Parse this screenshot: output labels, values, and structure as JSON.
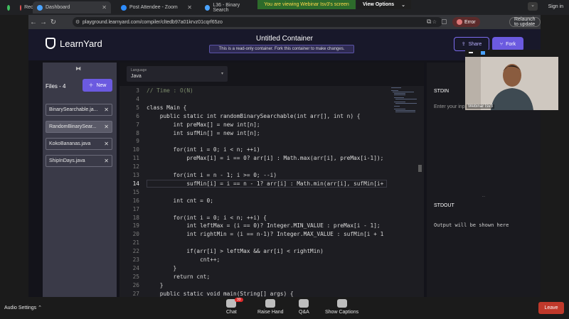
{
  "tabs": [
    {
      "label": "Recording",
      "color": "#e05555"
    },
    {
      "label": "Dashboard",
      "color": "#4aa3ff"
    },
    {
      "label": "Post Attendee - Zoom",
      "color": "#2d8cff"
    },
    {
      "label": "L36 - Binary Search",
      "color": "#4aa3ff"
    }
  ],
  "zoom_banner": "You are viewing Webinar Isv3's screen",
  "view_options": "View Options",
  "sign_in": "Sign in",
  "url": "playground.learnyard.com/compiler/cltedb97a01krvz01cqrf65zo",
  "error_label": "Error",
  "relaunch": "Relaunch to update",
  "app": {
    "logo": "LearnYard",
    "title": "Untitled Container",
    "readonly_note": "This is a read-only container. Fork this container to make changes.",
    "share": "Share",
    "fork": "Fork"
  },
  "sidebar": {
    "files_label": "Files - 4",
    "new_label": "New",
    "files": [
      "BinarySearchable.ja...",
      "RandomBinarySear...",
      "KokoBananas.java",
      "ShipInDays.java"
    ]
  },
  "editor": {
    "lang_label": "Language",
    "lang_value": "Java",
    "current_line": 14,
    "lines": [
      {
        "n": "3",
        "t": "// Time : O(N)"
      },
      {
        "n": "4",
        "t": ""
      },
      {
        "n": "5",
        "t": "class Main {"
      },
      {
        "n": "6",
        "t": "    public static int randomBinarySearchable(int arr[], int n) {"
      },
      {
        "n": "7",
        "t": "        int preMax[] = new int[n];"
      },
      {
        "n": "8",
        "t": "        int sufMin[] = new int[n];"
      },
      {
        "n": "9",
        "t": ""
      },
      {
        "n": "10",
        "t": "        for(int i = 0; i < n; ++i)"
      },
      {
        "n": "11",
        "t": "            preMax[i] = i == 0? arr[i] : Math.max(arr[i], preMax[i-1]);"
      },
      {
        "n": "12",
        "t": ""
      },
      {
        "n": "13",
        "t": "        for(int i = n - 1; i >= 0; --i)"
      },
      {
        "n": "14",
        "t": "            sufMin[i] = i == n - 1? arr[i] : Math.min(arr[i], sufMin[i+"
      },
      {
        "n": "15",
        "t": ""
      },
      {
        "n": "16",
        "t": "        int cnt = 0;"
      },
      {
        "n": "17",
        "t": ""
      },
      {
        "n": "18",
        "t": "        for(int i = 0; i < n; ++i) {"
      },
      {
        "n": "19",
        "t": "            int leftMax = (i == 0)? Integer.MIN_VALUE : preMax[i - 1];"
      },
      {
        "n": "20",
        "t": "            int rightMin = (i == n-1)? Integer.MAX_VALUE : sufMin[i + 1"
      },
      {
        "n": "21",
        "t": ""
      },
      {
        "n": "22",
        "t": "            if(arr[i] > leftMax && arr[i] < rightMin)"
      },
      {
        "n": "23",
        "t": "                cnt++;"
      },
      {
        "n": "24",
        "t": "        }"
      },
      {
        "n": "25",
        "t": "        return cnt;"
      },
      {
        "n": "26",
        "t": "    }"
      },
      {
        "n": "27",
        "t": "    public static void main(String[] args) {"
      }
    ]
  },
  "stdin_label": "STDIN",
  "stdin_placeholder": "Enter your input here",
  "stdout_label": "STDOUT",
  "stdout_text": "Output will be shown here",
  "webcam_name": "Webinar Isv3",
  "zoom": {
    "audio": "Audio Settings",
    "chat": "Chat",
    "chat_count": "33",
    "raise": "Raise Hand",
    "qa": "Q&A",
    "captions": "Show Captions",
    "leave": "Leave"
  }
}
